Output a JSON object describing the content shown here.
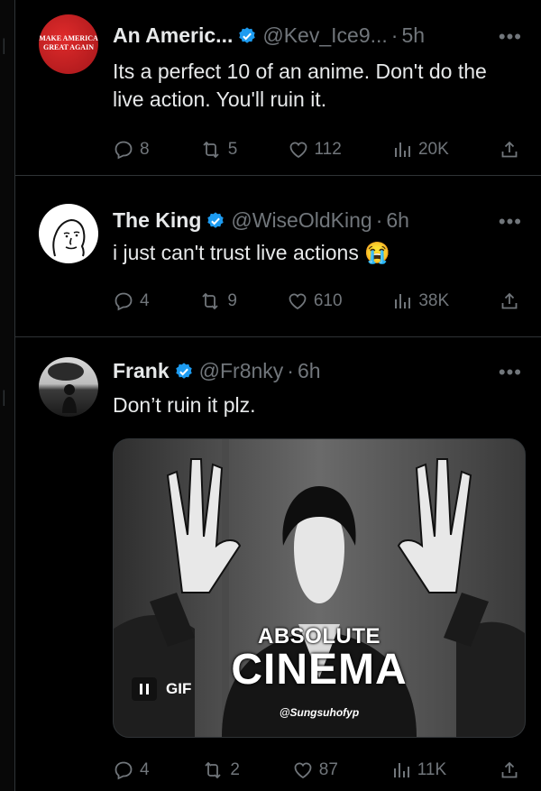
{
  "tweets": [
    {
      "name": "An Americ...",
      "handle": "@Kev_Ice9...",
      "separator": "·",
      "time": "5h",
      "avatar_text": [
        "MAKE AMERICA",
        "GREAT AGAIN"
      ],
      "text": "Its a perfect 10 of an anime. Don't do the live action. You'll ruin it.",
      "replies": "8",
      "reposts": "5",
      "likes": "112",
      "views": "20K"
    },
    {
      "name": "The King",
      "handle": "@WiseOldKing",
      "separator": "·",
      "time": "6h",
      "text": "i just can't trust live actions",
      "emoji": "😭",
      "replies": "4",
      "reposts": "9",
      "likes": "610",
      "views": "38K"
    },
    {
      "name": "Frank",
      "handle": "@Fr8nky",
      "separator": "·",
      "time": "6h",
      "text": "Don’t ruin it plz.",
      "media": {
        "badge": "GIF",
        "caption_top": "ABSOLUTE",
        "caption_main": "CINEMA",
        "watermark": "@Sungsuhofyp"
      },
      "replies": "4",
      "reposts": "2",
      "likes": "87",
      "views": "11K"
    }
  ],
  "colors": {
    "background": "#000000",
    "text": "#e7e9ea",
    "muted": "#71767b",
    "verified": "#1d9bf0",
    "divider": "#2f3336"
  }
}
